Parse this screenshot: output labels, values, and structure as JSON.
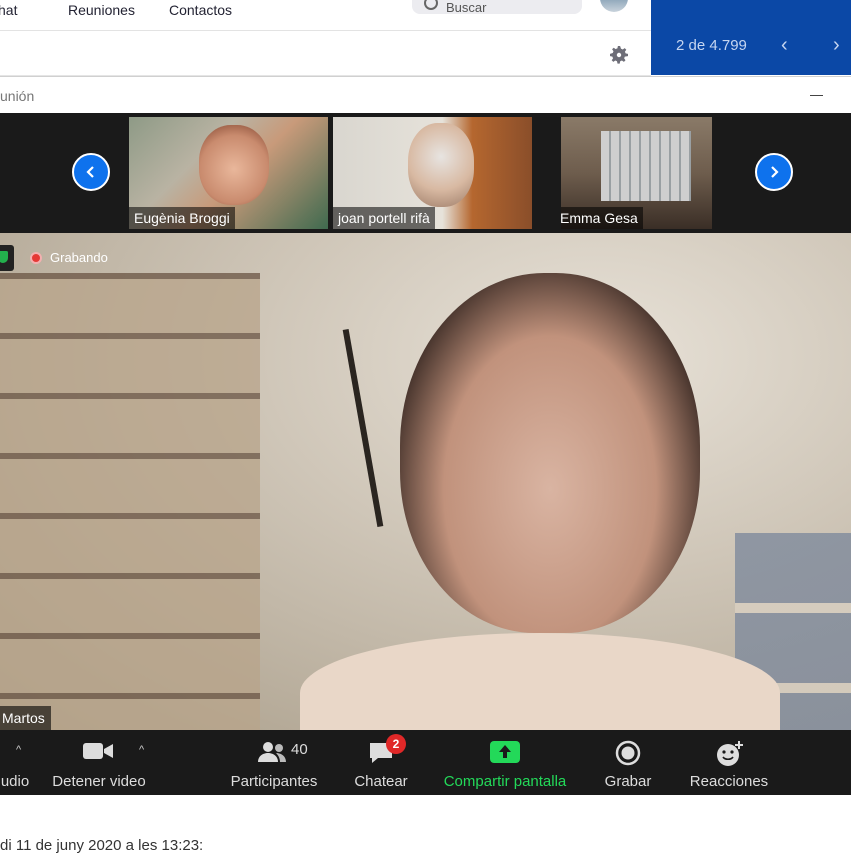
{
  "topbar": {
    "tab_chat": "hat",
    "tab_meetings": "Reuniones",
    "tab_contacts": "Contactos",
    "search_placeholder": "Buscar"
  },
  "mail_nav": {
    "counter": "2 de 4.799",
    "prev_icon": "chevron-left-icon",
    "next_icon": "chevron-right-icon",
    "background": "#0b48a6"
  },
  "meeting": {
    "window_title": "unión",
    "recording_label": "Grabando",
    "speaker_name": "Martos",
    "participants": [
      {
        "name": "Eugènia Broggi",
        "muted": false
      },
      {
        "name": "joan portell rifà",
        "muted": false
      },
      {
        "name": "Emma Gesa",
        "muted": true
      }
    ]
  },
  "toolbar": {
    "audio_label": "udio",
    "video_label": "Detener video",
    "participants_label": "Participantes",
    "participants_count": "40",
    "chat_label": "Chatear",
    "chat_badge": "2",
    "share_label": "Compartir pantalla",
    "record_label": "Grabar",
    "reactions_label": "Reacciones",
    "accent_green": "#23d959",
    "accent_blue": "#0e72ed"
  },
  "footer": {
    "text": "di  11 de juny 2020 a les 13:23:"
  }
}
